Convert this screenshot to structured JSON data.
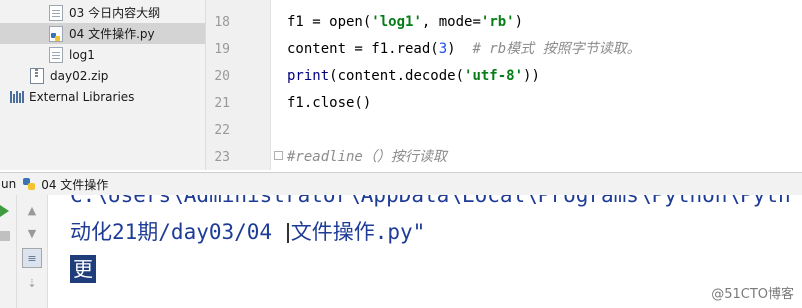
{
  "project_tree": {
    "items": [
      {
        "label": "03 今日内容大纲",
        "icon": "text-file-icon"
      },
      {
        "label": "04 文件操作.py",
        "icon": "python-file-icon",
        "selected": true
      },
      {
        "label": "log1",
        "icon": "text-file-icon"
      },
      {
        "label": "day02.zip",
        "icon": "zip-file-icon"
      },
      {
        "label": "External Libraries",
        "icon": "library-icon"
      }
    ]
  },
  "editor": {
    "lines": [
      {
        "num": "18"
      },
      {
        "num": "19"
      },
      {
        "num": "20"
      },
      {
        "num": "21",
        "current": true
      },
      {
        "num": "22"
      },
      {
        "num": "23"
      }
    ],
    "code": {
      "l18_pre": "f1 = open(",
      "l18_s1": "'log1'",
      "l18_mid": ", mode=",
      "l18_s2": "'rb'",
      "l18_post": ")",
      "l19_pre": "content = f1.read(",
      "l19_num": "3",
      "l19_post": ")  ",
      "l19_comment": "# rb模式 按照字节读取。",
      "l20_kw": "print",
      "l20_pre": "(content.decode(",
      "l20_s": "'utf-8'",
      "l20_post": "))",
      "l21": "f1.close()",
      "l23_comment": "#readline（）按行读取"
    }
  },
  "run_panel": {
    "header_prefix": "un",
    "tab_label": "04 文件操作",
    "console": {
      "line1": "C:\\Users\\Administrator\\AppData\\Local\\Programs\\Python\\Pyth",
      "line2_a": "动化21期/day03/04 ",
      "line2_b": "文件操作.py\"",
      "selected_char": "更"
    }
  },
  "watermark": "@51CTO博客"
}
